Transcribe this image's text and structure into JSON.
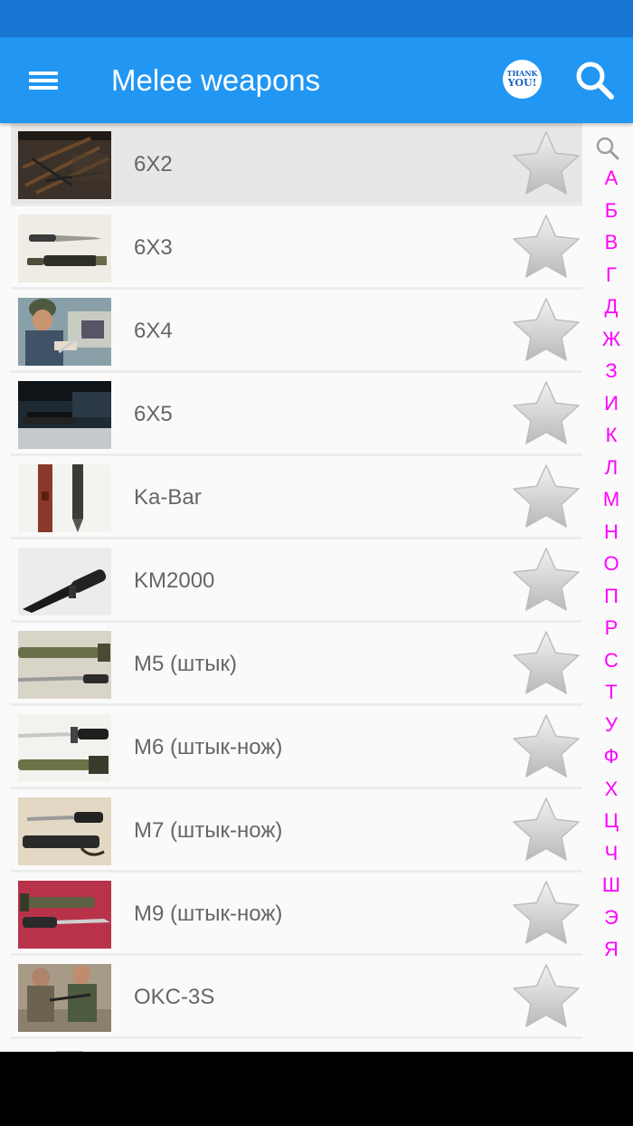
{
  "header": {
    "title": "Melee weapons",
    "thanks_line1": "THANK",
    "thanks_line2": "YOU!"
  },
  "colors": {
    "status_bar": "#1976d2",
    "app_bar": "#2196f3",
    "index_letters": "#ff00ff",
    "list_text": "#666666",
    "selected_row": "#e7e7e7"
  },
  "items": [
    {
      "label": "6X2",
      "thumb": "rifles-on-wall",
      "favorite": false,
      "selected": true
    },
    {
      "label": "6X3",
      "thumb": "bayonet-with-scabbard",
      "favorite": false
    },
    {
      "label": "6X4",
      "thumb": "soldier-with-bayonet",
      "favorite": false
    },
    {
      "label": "6X5",
      "thumb": "bayonet-on-table",
      "favorite": false
    },
    {
      "label": "Ka-Bar",
      "thumb": "ka-bar-knife",
      "favorite": false
    },
    {
      "label": "KM2000",
      "thumb": "km2000-knife",
      "favorite": false
    },
    {
      "label": "M5 (штык)",
      "thumb": "m5-bayonet",
      "favorite": false
    },
    {
      "label": "M6 (штык-нож)",
      "thumb": "m6-bayonet",
      "favorite": false
    },
    {
      "label": "M7 (штык-нож)",
      "thumb": "m7-bayonet",
      "favorite": false
    },
    {
      "label": "M9 (штык-нож)",
      "thumb": "m9-bayonet",
      "favorite": false
    },
    {
      "label": "OKC-3S",
      "thumb": "okc-3s-training",
      "favorite": false
    }
  ],
  "index_letters": [
    "А",
    "Б",
    "В",
    "Г",
    "Д",
    "Ж",
    "З",
    "И",
    "К",
    "Л",
    "М",
    "Н",
    "О",
    "П",
    "Р",
    "С",
    "Т",
    "У",
    "Ф",
    "Х",
    "Ц",
    "Ч",
    "Ш",
    "Э",
    "Я"
  ]
}
